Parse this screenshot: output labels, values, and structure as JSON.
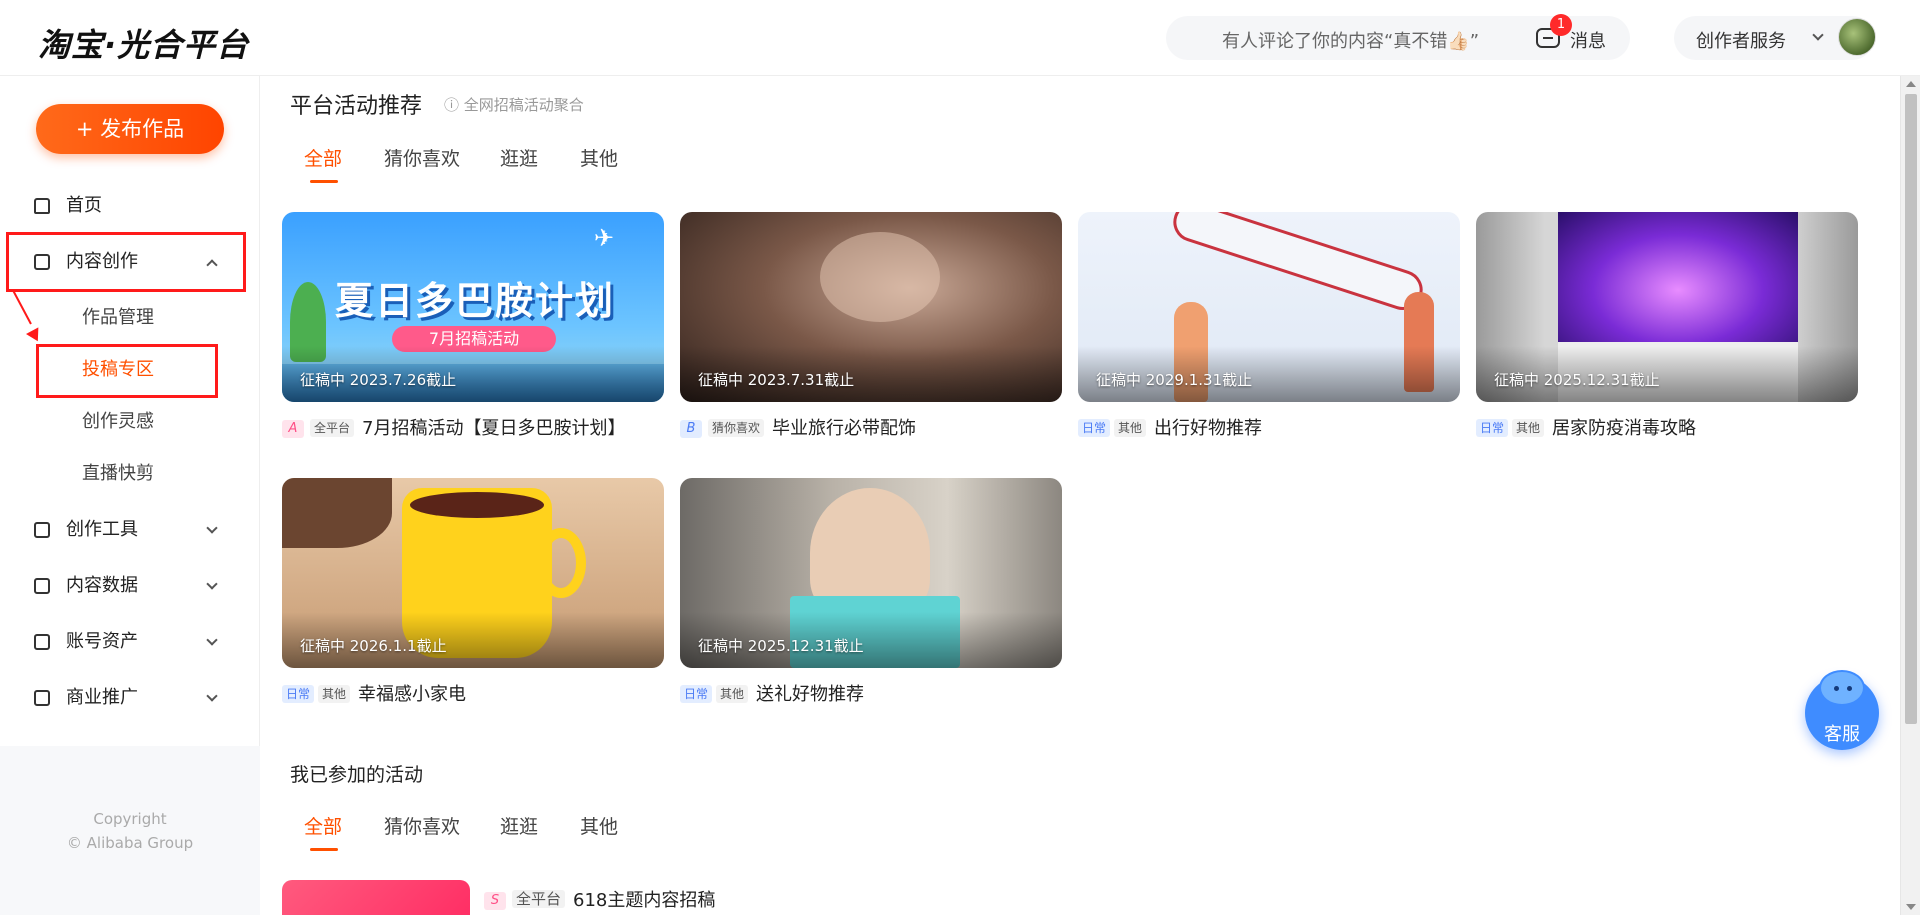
{
  "header": {
    "logo": "淘宝·光合平台",
    "notice": "有人评论了你的内容“真不错👍🏻”",
    "message_badge": "1",
    "message_label": "消息",
    "creator_service": "创作者服务"
  },
  "sidebar": {
    "publish_button": "+ 发布作品",
    "home": "首页",
    "content_creation": "内容创作",
    "sub_items": [
      "作品管理",
      "投稿专区",
      "创作灵感",
      "直播快剪"
    ],
    "tools": "创作工具",
    "data": "内容数据",
    "assets": "账号资产",
    "promotion": "商业推广",
    "copyright_line1": "Copyright",
    "copyright_line2": "© Alibaba Group"
  },
  "platform": {
    "title": "平台活动推荐",
    "subtitle": "ⓘ 全网招稿活动聚合",
    "tabs": [
      "全部",
      "猜你喜欢",
      "逛逛",
      "其他"
    ],
    "cards": [
      {
        "status": "征稿中 2023.7.26截止",
        "tag": "A",
        "scope": "全平台",
        "title": "7月招稿活动【夏日多巴胺计划】",
        "banner_title": "夏日多巴胺计划",
        "banner_sub": "7月招稿活动"
      },
      {
        "status": "征稿中 2023.7.31截止",
        "tag": "B",
        "scope": "猜你喜欢",
        "title": "毕业旅行必带配饰"
      },
      {
        "status": "征稿中 2029.1.31截止",
        "tag": "日常",
        "scope": "其他",
        "title": "出行好物推荐"
      },
      {
        "status": "征稿中 2025.12.31截止",
        "tag": "日常",
        "scope": "其他",
        "title": "居家防疫消毒攻略"
      },
      {
        "status": "征稿中 2026.1.1截止",
        "tag": "日常",
        "scope": "其他",
        "title": "幸福感小家电"
      },
      {
        "status": "征稿中 2025.12.31截止",
        "tag": "日常",
        "scope": "其他",
        "title": "送礼好物推荐"
      }
    ]
  },
  "joined": {
    "title": "我已参加的活动",
    "tabs": [
      "全部",
      "猜你喜欢",
      "逛逛",
      "其他"
    ],
    "item": {
      "tag": "S",
      "scope": "全平台",
      "title": "618主题内容招稿"
    }
  },
  "customer_service": "客服",
  "colors": {
    "accent": "#ff5000",
    "highlight_box": "#ff1a1a",
    "cs_blue": "#3f8cff"
  }
}
